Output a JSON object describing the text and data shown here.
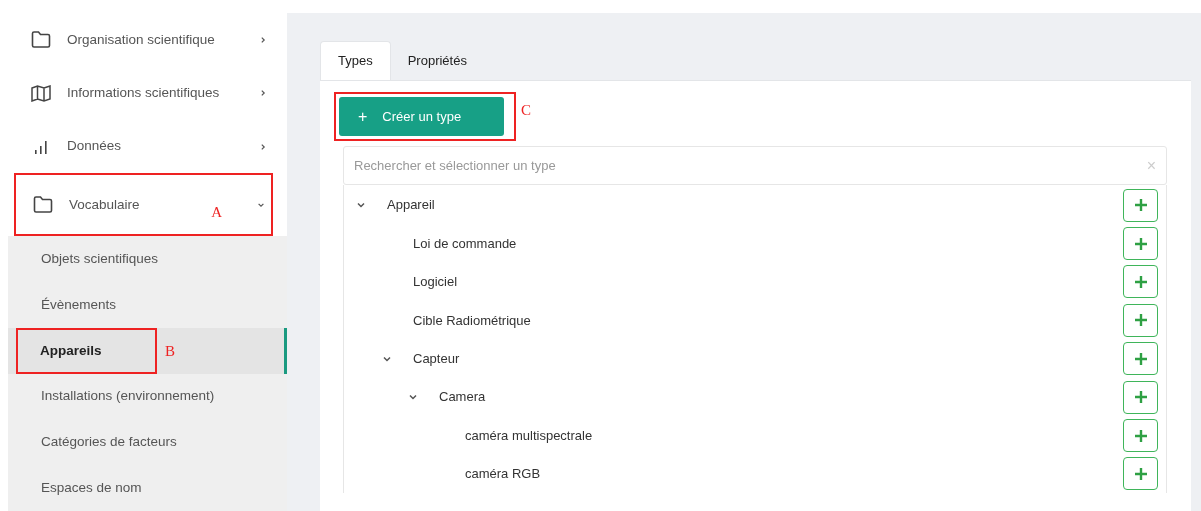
{
  "sidebar": {
    "items": [
      {
        "label": "Organisation scientifique",
        "kind": "folder",
        "expanded": false
      },
      {
        "label": "Informations scientifiques",
        "kind": "map",
        "expanded": false
      },
      {
        "label": "Données",
        "kind": "chart",
        "expanded": false
      },
      {
        "label": "Vocabulaire",
        "kind": "folder",
        "expanded": true,
        "annotation": "A",
        "children": [
          {
            "label": "Objets scientifiques",
            "selected": false
          },
          {
            "label": "Évènements",
            "selected": false
          },
          {
            "label": "Appareils",
            "selected": true,
            "annotation": "B"
          },
          {
            "label": "Installations (environnement)",
            "selected": false
          },
          {
            "label": "Catégories de facteurs",
            "selected": false
          },
          {
            "label": "Espaces de nom",
            "selected": false
          }
        ]
      }
    ]
  },
  "tabs": [
    {
      "label": "Types",
      "selected": true
    },
    {
      "label": "Propriétés",
      "selected": false
    }
  ],
  "create_button": {
    "icon": "+",
    "label": "Créer un type",
    "annotation": "C"
  },
  "search": {
    "placeholder": "Rechercher et sélectionner un type",
    "clear": "×"
  },
  "tree": [
    {
      "label": "Appareil",
      "expanded": true,
      "children": [
        {
          "label": "Loi de commande"
        },
        {
          "label": "Logiciel"
        },
        {
          "label": "Cible Radiométrique"
        },
        {
          "label": "Capteur",
          "expanded": true,
          "children": [
            {
              "label": "Camera",
              "expanded": true,
              "children": [
                {
                  "label": "caméra multispectrale"
                },
                {
                  "label": "caméra RGB"
                }
              ]
            }
          ]
        }
      ]
    }
  ]
}
